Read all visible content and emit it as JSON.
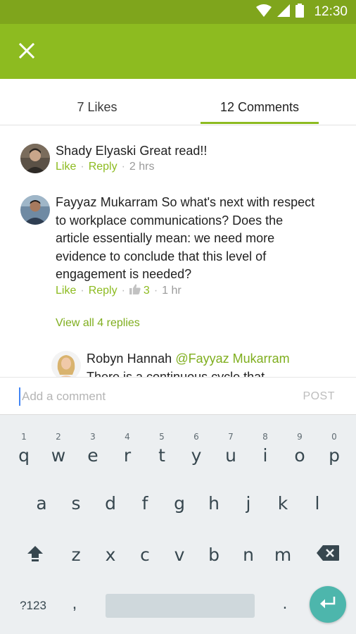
{
  "status_bar": {
    "time": "12:30",
    "icons": [
      "wifi-icon",
      "signal-icon",
      "battery-icon"
    ]
  },
  "app_bar": {
    "close_icon": "close-icon"
  },
  "tabs": [
    {
      "label": "7 Likes",
      "active": false
    },
    {
      "label": "12 Comments",
      "active": true
    }
  ],
  "comments": [
    {
      "author": "Shady Elyaski",
      "text": "Great read!!",
      "like_label": "Like",
      "reply_label": "Reply",
      "time": "2 hrs"
    },
    {
      "author": "Fayyaz Mukarram",
      "text_line1": "So what's next with respect",
      "text_rest": [
        "to workplace communications? Does the",
        "article essentially mean: we need more",
        "evidence to conclude that this level of",
        "engagement is needed?"
      ],
      "like_label": "Like",
      "reply_label": "Reply",
      "likes": "3",
      "time": "1 hr",
      "view_replies": "View all 4 replies"
    },
    {
      "author": "Robyn Hannah",
      "mention": "@Fayyaz Mukarram",
      "text": "There is a continuous cycle that"
    }
  ],
  "composer": {
    "placeholder": "Add a comment",
    "value": "",
    "post_label": "POST"
  },
  "keyboard": {
    "row1": [
      {
        "k": "q",
        "n": "1"
      },
      {
        "k": "w",
        "n": "2"
      },
      {
        "k": "e",
        "n": "3"
      },
      {
        "k": "r",
        "n": "4"
      },
      {
        "k": "t",
        "n": "5"
      },
      {
        "k": "y",
        "n": "6"
      },
      {
        "k": "u",
        "n": "7"
      },
      {
        "k": "i",
        "n": "8"
      },
      {
        "k": "o",
        "n": "9"
      },
      {
        "k": "p",
        "n": "0"
      }
    ],
    "row2": [
      "a",
      "s",
      "d",
      "f",
      "g",
      "h",
      "j",
      "k",
      "l"
    ],
    "row3": [
      "z",
      "x",
      "c",
      "v",
      "b",
      "n",
      "m"
    ],
    "symbols_label": "?123",
    "comma": ",",
    "period": "."
  },
  "colors": {
    "accent": "#8dbb20",
    "status_bar": "#7fa51c",
    "enter": "#4db6ac",
    "keyboard_bg": "#eceff1"
  }
}
